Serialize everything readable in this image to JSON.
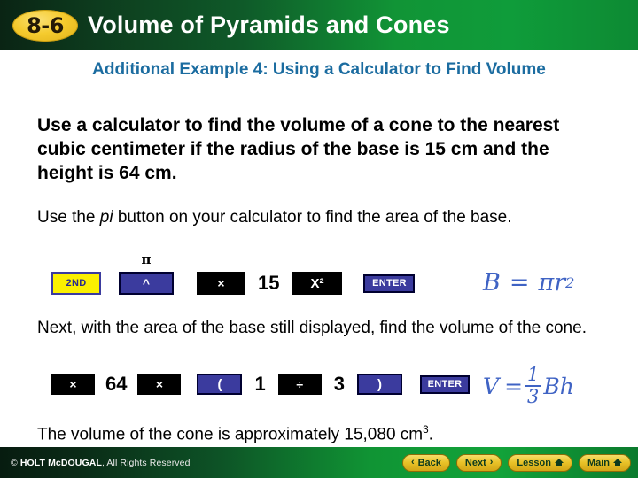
{
  "header": {
    "badge": "8-6",
    "title": "Volume of Pyramids and Cones"
  },
  "main": {
    "subtitle": "Additional Example 4: Using a Calculator to Find Volume",
    "problem": "Use a calculator to find the volume of a cone to the nearest cubic centimeter if the radius of the base is 15 cm and the height is 64 cm.",
    "step1_text_before": "Use the ",
    "step1_italic": "pi",
    "step1_text_after": " button on your calculator to find the area of the base.",
    "step2_text": "Next, with the area of the base still displayed, find the volume of the cone.",
    "conclusion_before": "The volume of the cone is approximately 15,080 cm",
    "conclusion_sup": "3",
    "conclusion_after": ".",
    "keys_row1": {
      "pi_label": "π",
      "second": "2ND",
      "power": "^",
      "multiply": "×",
      "radius": "15",
      "square": "X²",
      "enter": "ENTER"
    },
    "keys_row2": {
      "multiply1": "×",
      "height": "64",
      "multiply2": "×",
      "open_paren": "(",
      "numerator": "1",
      "divide": "÷",
      "denominator": "3",
      "close_paren": ")",
      "enter": "ENTER"
    },
    "formula_base": {
      "lhs": "B",
      "equals": "=",
      "pi": "π",
      "variable": "r",
      "exponent": "2"
    },
    "formula_volume": {
      "lhs": "V",
      "equals": "=",
      "numerator": "1",
      "denominator": "3",
      "rhs": "Bh"
    }
  },
  "footer": {
    "copyright_symbol": "© ",
    "copyright_brand": "HOLT McDOUGAL",
    "copyright_rest": ", All Rights Reserved",
    "buttons": {
      "back": "Back",
      "next": "Next",
      "lesson": "Lesson",
      "main": "Main"
    },
    "back_chevron": "‹",
    "next_chevron": "›"
  },
  "colors": {
    "header_green": "#109434",
    "badge_gold": "#f5cb2e",
    "subtitle_blue": "#1b6ca0",
    "formula_blue": "#3f63c4",
    "key_blue": "#3b3b9e",
    "key_yellow": "#fbf000",
    "nav_gold": "#e9c329"
  }
}
